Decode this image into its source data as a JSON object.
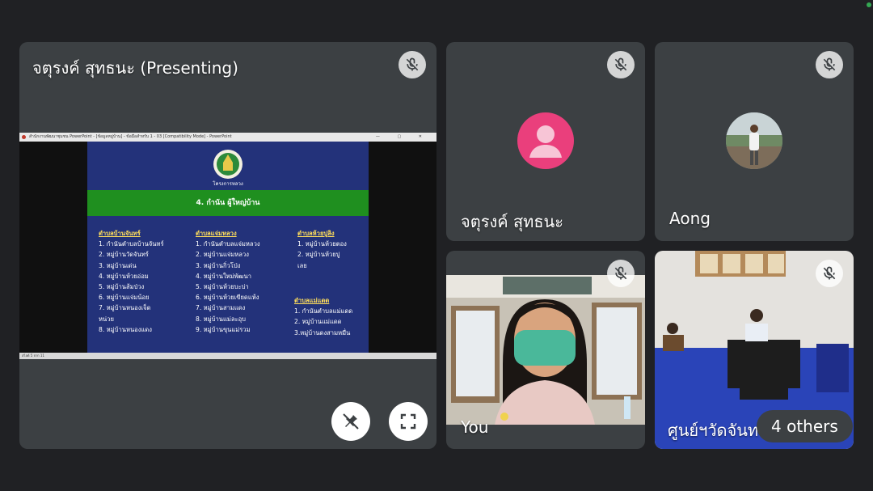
{
  "presenter_tile": {
    "name": "จตุรงค์ สุทธนะ (Presenting)",
    "ppt_window_title": "สำนักงานพัฒนาชุมชน PowerPoint - [ข้อมูลหมู่บ้าน] - ข้อมือสำหรับ 1 - 03 [Compatibility Mode] - PowerPoint",
    "ppt_window_controls": "— ▢ ✕",
    "ppt_status_text": "สไลด์ 5 จาก 11",
    "slide": {
      "logo_text": "โครงการหลวง",
      "heading": "4. กำนัน ผู้ใหญ่บ้าน",
      "columns": [
        {
          "header": "ตำบลบ้านจันทร์",
          "items": [
            "1. กำนันตำบลบ้านจันทร์",
            "2. หมู่บ้านวัดจันทร์",
            "3. หมู่บ้านเด่น",
            "4. หมู่บ้านห้วยอ่อม",
            "5. หมู่บ้านส้มป่วง",
            "6. หมู่บ้านแจ่มน้อย",
            "7. หมู่บ้านหนองเจ็ด",
            "หน่วย",
            "8. หมู่บ้านหนองแดง"
          ]
        },
        {
          "header": "ตำบลแจ่มหลวง",
          "items": [
            "1. กำนันตำบลแจ่มหลวง",
            "2. หมู่บ้านแจ่มหลวง",
            "3. หมู่บ้านกิ่วโป่ง",
            "4. หมู่บ้านใหม่พัฒนา",
            "5. หมู่บ้านห้วยบะบ่า",
            "6. หมู่บ้านห้วยเขียดแห้ง",
            "7. หมู่บ้านสามแดง",
            "8. หมู่บ้านแม่ละอุบ",
            "9. หมู่บ้านขุนแม่รวม"
          ]
        },
        {
          "header": "ตำบลห้วยปูลิง",
          "items": [
            "1. หมู่บ้านห้วยตอง",
            "2. หมู่บ้านห้วยปู",
            "เลย"
          ]
        },
        {
          "header": "ตำบลแม่แดด",
          "items": [
            "1. กำนันตำบลแม่แดด",
            "2. หมู่บ้านแม่แดด",
            "3.หมู่บ้านดงสามหมื่น"
          ]
        }
      ]
    }
  },
  "participants": [
    {
      "name": "จตุรงค์ สุทธนะ",
      "avatar": "default-person-icon"
    },
    {
      "name": "Aong",
      "avatar": "profile-photo"
    },
    {
      "name": "You",
      "avatar": "camera-feed"
    },
    {
      "name": "ศูนย์ฯวัดจันท",
      "avatar": "camera-feed"
    }
  ],
  "others_count_label": "4 others",
  "icons": {
    "mic_off": "mic-off-icon",
    "unpin": "unpin-icon",
    "fullscreen": "fullscreen-icon"
  },
  "colors": {
    "background": "#202124",
    "tile": "#3c4043",
    "avatar_pink": "#ea3f7c",
    "slide_blue": "#23327a",
    "slide_green": "#1f8f1f",
    "slide_header_yellow": "#ffde5b"
  }
}
